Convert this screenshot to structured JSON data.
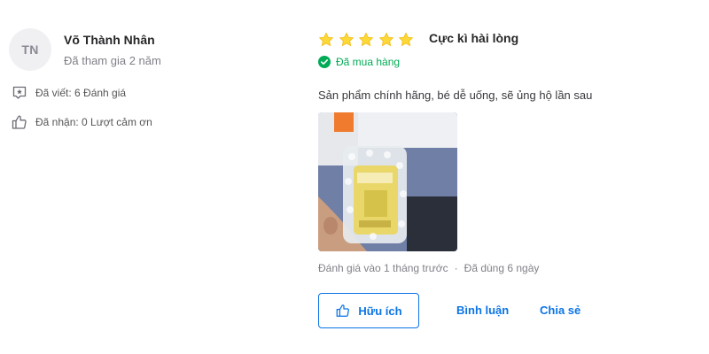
{
  "reviewer": {
    "initials": "TN",
    "name": "Võ Thành Nhân",
    "joined": "Đã tham gia 2 năm"
  },
  "stats": {
    "written": "Đã viết: 6 Đánh giá",
    "thanks": "Đã nhận: 0 Lượt cảm ơn"
  },
  "review": {
    "rating": 5,
    "rating_max": 5,
    "rating_title": "Cực kì hài lòng",
    "purchased": "Đã mua hàng",
    "text": "Sản phẩm chính hãng, bé dễ uống, sẽ ủng hộ lần sau",
    "posted": "Đánh giá vào 1 tháng trước",
    "separator": "·",
    "used": "Đã dùng 6 ngày"
  },
  "actions": {
    "helpful": "Hữu ích",
    "comment": "Bình luận",
    "share": "Chia sẻ"
  },
  "icons": {
    "review_count": "chat-bubble-star-icon",
    "thanks": "thumb-up-icon",
    "star": "star-icon",
    "purchased": "check-circle-icon"
  },
  "colors": {
    "star": "#fdd836",
    "purchased": "#00ab56",
    "action": "#0b74e5",
    "muted": "#808089"
  }
}
